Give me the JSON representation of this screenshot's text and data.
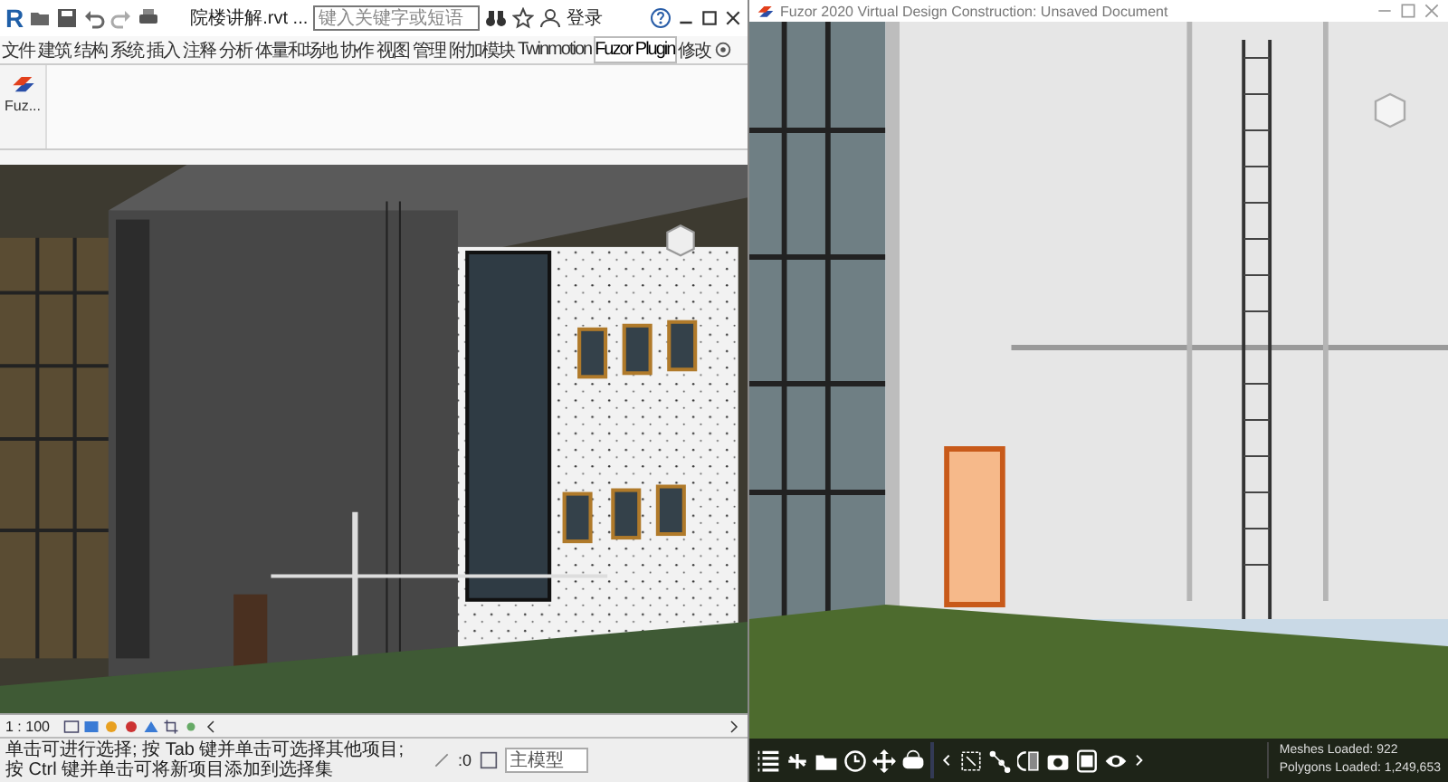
{
  "revit": {
    "logo": "R",
    "file_title": "院楼讲解.rvt ...",
    "search": {
      "placeholder": "键入关键字或短语"
    },
    "sign_in": "登录",
    "ribbon_tabs": [
      {
        "label": "文件",
        "selected": false
      },
      {
        "label": "建筑",
        "selected": false
      },
      {
        "label": "结构",
        "selected": false
      },
      {
        "label": "系统",
        "selected": false
      },
      {
        "label": "插入",
        "selected": false
      },
      {
        "label": "注释",
        "selected": false
      },
      {
        "label": "分析",
        "selected": false
      },
      {
        "label": "体量和场地",
        "selected": false
      },
      {
        "label": "协作",
        "selected": false
      },
      {
        "label": "视图",
        "selected": false
      },
      {
        "label": "管理",
        "selected": false
      },
      {
        "label": "附加模块",
        "selected": false
      },
      {
        "label": "Twinmotion",
        "selected": false
      },
      {
        "label": "Fuzor Plugin",
        "selected": true
      },
      {
        "label": "修改",
        "selected": false
      }
    ],
    "ribbon_button": {
      "label": "Fuz..."
    },
    "view_scale": "1 : 100",
    "status_text": "单击可进行选择; 按 Tab 键并单击可选择其他项目; 按 Ctrl 键并单击可将新项目添加到选择集",
    "status_count": ":0",
    "model_field": {
      "value": "主模型"
    }
  },
  "fuzor": {
    "title": "Fuzor 2020 Virtual Design Construction: Unsaved Document",
    "stats": [
      "Meshes Loaded: 922",
      "Polygons Loaded: 1,249,653"
    ]
  }
}
